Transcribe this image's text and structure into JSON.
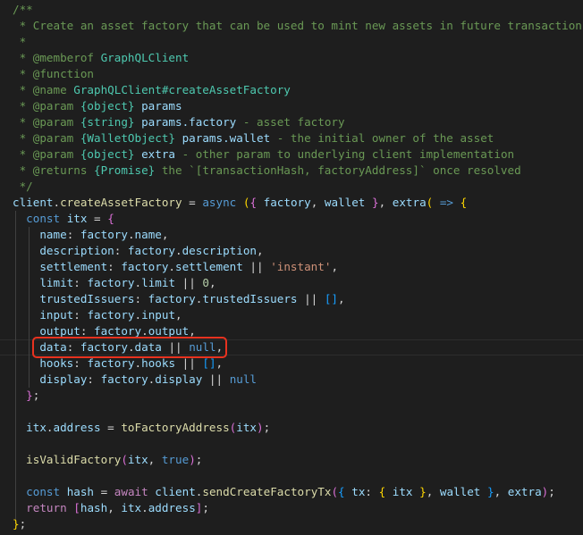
{
  "colors": {
    "background": "#1e1e1e",
    "comment": "#6a9955",
    "function": "#dcdcaa",
    "variable": "#9cdcfe",
    "keyword": "#569cd6",
    "control": "#c586c0",
    "type": "#4ec9b0",
    "string": "#ce9178",
    "number": "#b5cea8",
    "operator": "#d4d4d4",
    "bracket_1": "#ffd700",
    "bracket_2": "#da70d6",
    "bracket_3": "#179fff",
    "highlight_box": "#e8321f"
  },
  "code_lines": [
    [
      [
        "/**",
        "comment"
      ]
    ],
    [
      [
        " * Create an asset factory that can be used to mint new assets in future transactions",
        "comment"
      ]
    ],
    [
      [
        " *",
        "comment"
      ]
    ],
    [
      [
        " * @memberof ",
        "comment"
      ],
      [
        "GraphQLClient",
        "type"
      ]
    ],
    [
      [
        " * @function",
        "comment"
      ]
    ],
    [
      [
        " * @name ",
        "comment"
      ],
      [
        "GraphQLClient#createAssetFactory",
        "type"
      ]
    ],
    [
      [
        " * @param ",
        "comment"
      ],
      [
        "{object}",
        "type"
      ],
      [
        " ",
        "comment"
      ],
      [
        "params",
        "var"
      ]
    ],
    [
      [
        " * @param ",
        "comment"
      ],
      [
        "{string}",
        "type"
      ],
      [
        " ",
        "comment"
      ],
      [
        "params.factory",
        "var"
      ],
      [
        " - asset factory",
        "comment"
      ]
    ],
    [
      [
        " * @param ",
        "comment"
      ],
      [
        "{WalletObject}",
        "type"
      ],
      [
        " ",
        "comment"
      ],
      [
        "params.wallet",
        "var"
      ],
      [
        " - the initial owner of the asset",
        "comment"
      ]
    ],
    [
      [
        " * @param ",
        "comment"
      ],
      [
        "{object}",
        "type"
      ],
      [
        " ",
        "comment"
      ],
      [
        "extra",
        "var"
      ],
      [
        " - other param to underlying client implementation",
        "comment"
      ]
    ],
    [
      [
        " * @returns ",
        "comment"
      ],
      [
        "{Promise}",
        "type"
      ],
      [
        " the `[transactionHash, factoryAddress]` once resolved",
        "comment"
      ]
    ],
    [
      [
        " */",
        "comment"
      ]
    ],
    [
      [
        "client",
        "var"
      ],
      [
        ".",
        "op"
      ],
      [
        "createAssetFactory",
        "fn"
      ],
      [
        " = ",
        "op"
      ],
      [
        "async",
        "kw"
      ],
      [
        " ",
        "op"
      ],
      [
        "(",
        "b1"
      ],
      [
        "{",
        "b2"
      ],
      [
        " ",
        "op"
      ],
      [
        "factory",
        "var"
      ],
      [
        ", ",
        "op"
      ],
      [
        "wallet",
        "var"
      ],
      [
        " ",
        "op"
      ],
      [
        "}",
        "b2"
      ],
      [
        ", ",
        "op"
      ],
      [
        "extra",
        "var"
      ],
      [
        "(",
        "b1"
      ],
      [
        " ",
        "op"
      ],
      [
        "=>",
        "kw"
      ],
      [
        " ",
        "op"
      ],
      [
        "{",
        "b1"
      ]
    ],
    [
      [
        "  ",
        "op"
      ],
      [
        "const",
        "kw"
      ],
      [
        " ",
        "op"
      ],
      [
        "itx",
        "var"
      ],
      [
        " = ",
        "op"
      ],
      [
        "{",
        "b2"
      ]
    ],
    [
      [
        "    ",
        "op"
      ],
      [
        "name",
        "var"
      ],
      [
        ": ",
        "op"
      ],
      [
        "factory",
        "var"
      ],
      [
        ".",
        "op"
      ],
      [
        "name",
        "var"
      ],
      [
        ",",
        "op"
      ]
    ],
    [
      [
        "    ",
        "op"
      ],
      [
        "description",
        "var"
      ],
      [
        ": ",
        "op"
      ],
      [
        "factory",
        "var"
      ],
      [
        ".",
        "op"
      ],
      [
        "description",
        "var"
      ],
      [
        ",",
        "op"
      ]
    ],
    [
      [
        "    ",
        "op"
      ],
      [
        "settlement",
        "var"
      ],
      [
        ": ",
        "op"
      ],
      [
        "factory",
        "var"
      ],
      [
        ".",
        "op"
      ],
      [
        "settlement",
        "var"
      ],
      [
        " || ",
        "op"
      ],
      [
        "'instant'",
        "str"
      ],
      [
        ",",
        "op"
      ]
    ],
    [
      [
        "    ",
        "op"
      ],
      [
        "limit",
        "var"
      ],
      [
        ": ",
        "op"
      ],
      [
        "factory",
        "var"
      ],
      [
        ".",
        "op"
      ],
      [
        "limit",
        "var"
      ],
      [
        " || ",
        "op"
      ],
      [
        "0",
        "num"
      ],
      [
        ",",
        "op"
      ]
    ],
    [
      [
        "    ",
        "op"
      ],
      [
        "trustedIssuers",
        "var"
      ],
      [
        ": ",
        "op"
      ],
      [
        "factory",
        "var"
      ],
      [
        ".",
        "op"
      ],
      [
        "trustedIssuers",
        "var"
      ],
      [
        " || ",
        "op"
      ],
      [
        "[]",
        "b3"
      ],
      [
        ",",
        "op"
      ]
    ],
    [
      [
        "    ",
        "op"
      ],
      [
        "input",
        "var"
      ],
      [
        ": ",
        "op"
      ],
      [
        "factory",
        "var"
      ],
      [
        ".",
        "op"
      ],
      [
        "input",
        "var"
      ],
      [
        ",",
        "op"
      ]
    ],
    [
      [
        "    ",
        "op"
      ],
      [
        "output",
        "var"
      ],
      [
        ": ",
        "op"
      ],
      [
        "factory",
        "var"
      ],
      [
        ".",
        "op"
      ],
      [
        "output",
        "var"
      ],
      [
        ",",
        "op"
      ]
    ],
    [
      [
        "    ",
        "op"
      ],
      [
        "data",
        "var"
      ],
      [
        ": ",
        "op"
      ],
      [
        "factory",
        "var"
      ],
      [
        ".",
        "op"
      ],
      [
        "data",
        "var"
      ],
      [
        " || ",
        "op"
      ],
      [
        "null",
        "kw"
      ],
      [
        ",",
        "op"
      ]
    ],
    [
      [
        "    ",
        "op"
      ],
      [
        "hooks",
        "var"
      ],
      [
        ": ",
        "op"
      ],
      [
        "factory",
        "var"
      ],
      [
        ".",
        "op"
      ],
      [
        "hooks",
        "var"
      ],
      [
        " || ",
        "op"
      ],
      [
        "[]",
        "b3"
      ],
      [
        ",",
        "op"
      ]
    ],
    [
      [
        "    ",
        "op"
      ],
      [
        "display",
        "var"
      ],
      [
        ": ",
        "op"
      ],
      [
        "factory",
        "var"
      ],
      [
        ".",
        "op"
      ],
      [
        "display",
        "var"
      ],
      [
        " || ",
        "op"
      ],
      [
        "null",
        "kw"
      ]
    ],
    [
      [
        "  ",
        "op"
      ],
      [
        "}",
        "b2"
      ],
      [
        ";",
        "op"
      ]
    ],
    [],
    [
      [
        "  ",
        "op"
      ],
      [
        "itx",
        "var"
      ],
      [
        ".",
        "op"
      ],
      [
        "address",
        "var"
      ],
      [
        " = ",
        "op"
      ],
      [
        "toFactoryAddress",
        "fn"
      ],
      [
        "(",
        "b2"
      ],
      [
        "itx",
        "var"
      ],
      [
        ")",
        "b2"
      ],
      [
        ";",
        "op"
      ]
    ],
    [],
    [
      [
        "  ",
        "op"
      ],
      [
        "isValidFactory",
        "fn"
      ],
      [
        "(",
        "b2"
      ],
      [
        "itx",
        "var"
      ],
      [
        ", ",
        "op"
      ],
      [
        "true",
        "kw"
      ],
      [
        ")",
        "b2"
      ],
      [
        ";",
        "op"
      ]
    ],
    [],
    [
      [
        "  ",
        "op"
      ],
      [
        "const",
        "kw"
      ],
      [
        " ",
        "op"
      ],
      [
        "hash",
        "var"
      ],
      [
        " = ",
        "op"
      ],
      [
        "await",
        "ctl"
      ],
      [
        " ",
        "op"
      ],
      [
        "client",
        "var"
      ],
      [
        ".",
        "op"
      ],
      [
        "sendCreateFactoryTx",
        "fn"
      ],
      [
        "(",
        "b2"
      ],
      [
        "{",
        "b3"
      ],
      [
        " ",
        "op"
      ],
      [
        "tx",
        "var"
      ],
      [
        ": ",
        "op"
      ],
      [
        "{",
        "b1"
      ],
      [
        " ",
        "op"
      ],
      [
        "itx",
        "var"
      ],
      [
        " ",
        "op"
      ],
      [
        "}",
        "b1"
      ],
      [
        ", ",
        "op"
      ],
      [
        "wallet",
        "var"
      ],
      [
        " ",
        "op"
      ],
      [
        "}",
        "b3"
      ],
      [
        ", ",
        "op"
      ],
      [
        "extra",
        "var"
      ],
      [
        ")",
        "b2"
      ],
      [
        ";",
        "op"
      ]
    ],
    [
      [
        "  ",
        "op"
      ],
      [
        "return",
        "ctl"
      ],
      [
        " ",
        "op"
      ],
      [
        "[",
        "b2"
      ],
      [
        "hash",
        "var"
      ],
      [
        ", ",
        "op"
      ],
      [
        "itx",
        "var"
      ],
      [
        ".",
        "op"
      ],
      [
        "address",
        "var"
      ],
      [
        "]",
        "b2"
      ],
      [
        ";",
        "op"
      ]
    ],
    [
      [
        "}",
        "b1"
      ],
      [
        ";",
        "op"
      ]
    ]
  ]
}
